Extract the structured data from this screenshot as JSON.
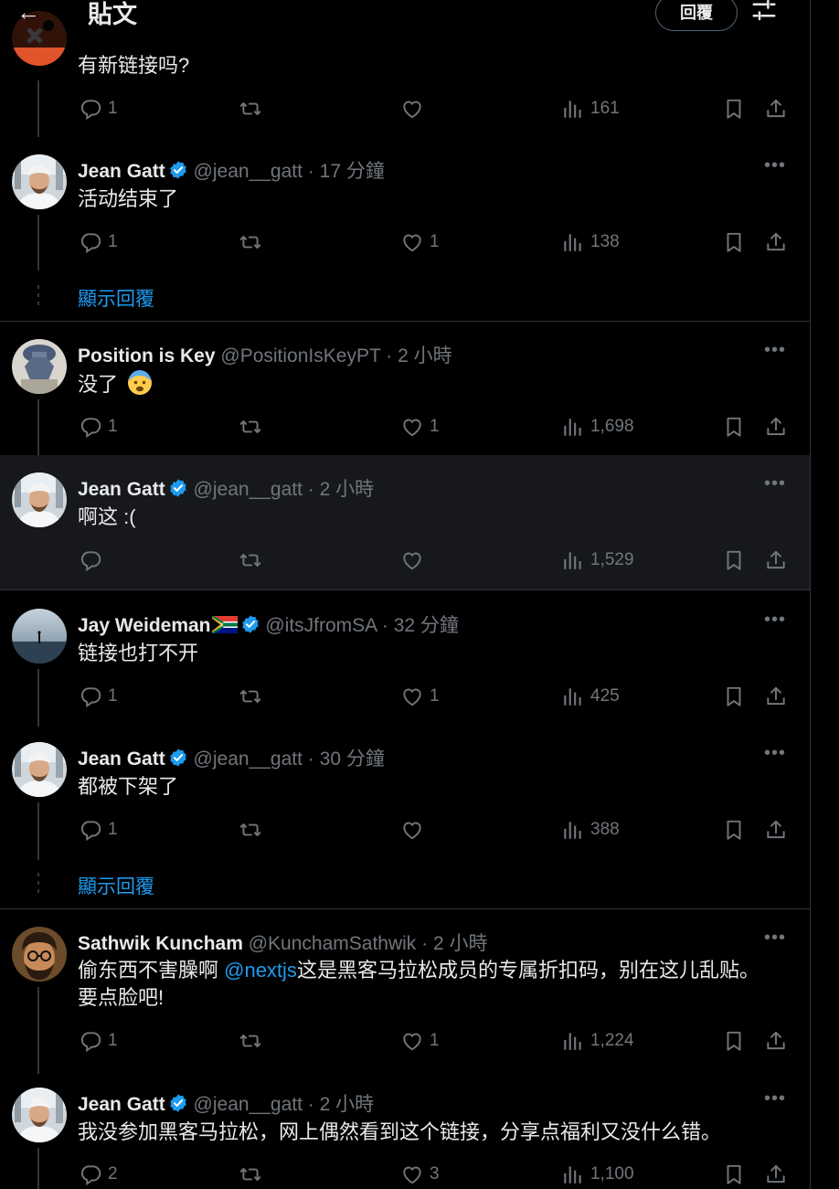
{
  "header": {
    "title": "貼文",
    "reply_button": "回覆"
  },
  "show_more_label": "顯示回覆",
  "tweets": [
    {
      "text": "有新链接吗?",
      "replies": "1",
      "retweets": "",
      "likes": "",
      "views": "161"
    },
    {
      "name": "Jean Gatt",
      "handle": "@jean__gatt",
      "time": "17 分鐘",
      "text": "活动结束了",
      "replies": "1",
      "retweets": "",
      "likes": "1",
      "views": "138"
    },
    {
      "name": "Position is Key",
      "handle": "@PositionIsKeyPT",
      "time": "2 小時",
      "text": "没了",
      "emoji": "anxious-face-emoji",
      "replies": "1",
      "retweets": "",
      "likes": "1",
      "views": "1,698"
    },
    {
      "name": "Jean Gatt",
      "handle": "@jean__gatt",
      "time": "2 小時",
      "text": "啊这 :(",
      "replies": "",
      "retweets": "",
      "likes": "",
      "views": "1,529"
    },
    {
      "name": "Jay Weideman",
      "handle": "@itsJfromSA",
      "time": "32 分鐘",
      "flag": "south-africa-flag",
      "text": "链接也打不开",
      "replies": "1",
      "retweets": "",
      "likes": "1",
      "views": "425"
    },
    {
      "name": "Jean Gatt",
      "handle": "@jean__gatt",
      "time": "30 分鐘",
      "text": "都被下架了",
      "replies": "1",
      "retweets": "",
      "likes": "",
      "views": "388"
    },
    {
      "name": "Sathwik Kuncham",
      "handle": "@KunchamSathwik",
      "time": "2 小時",
      "text_pre": "偷东西不害臊啊 ",
      "mention": "@nextjs",
      "text_post": "这是黑客马拉松成员的专属折扣码，别在这儿乱贴。",
      "text_line2": "要点脸吧!",
      "replies": "1",
      "retweets": "",
      "likes": "1",
      "views": "1,224"
    },
    {
      "name": "Jean Gatt",
      "handle": "@jean__gatt",
      "time": "2 小時",
      "text": "我没参加黑客马拉松，网上偶然看到这个链接，分享点福利又没什么错。",
      "replies": "2",
      "retweets": "",
      "likes": "3",
      "views": "1,100"
    }
  ],
  "colors": {
    "background": "#000000",
    "highlight": "#16181c",
    "accent": "#1d9bf0",
    "muted": "#71767b",
    "text": "#e7e9ea",
    "divider": "#2f3336"
  }
}
